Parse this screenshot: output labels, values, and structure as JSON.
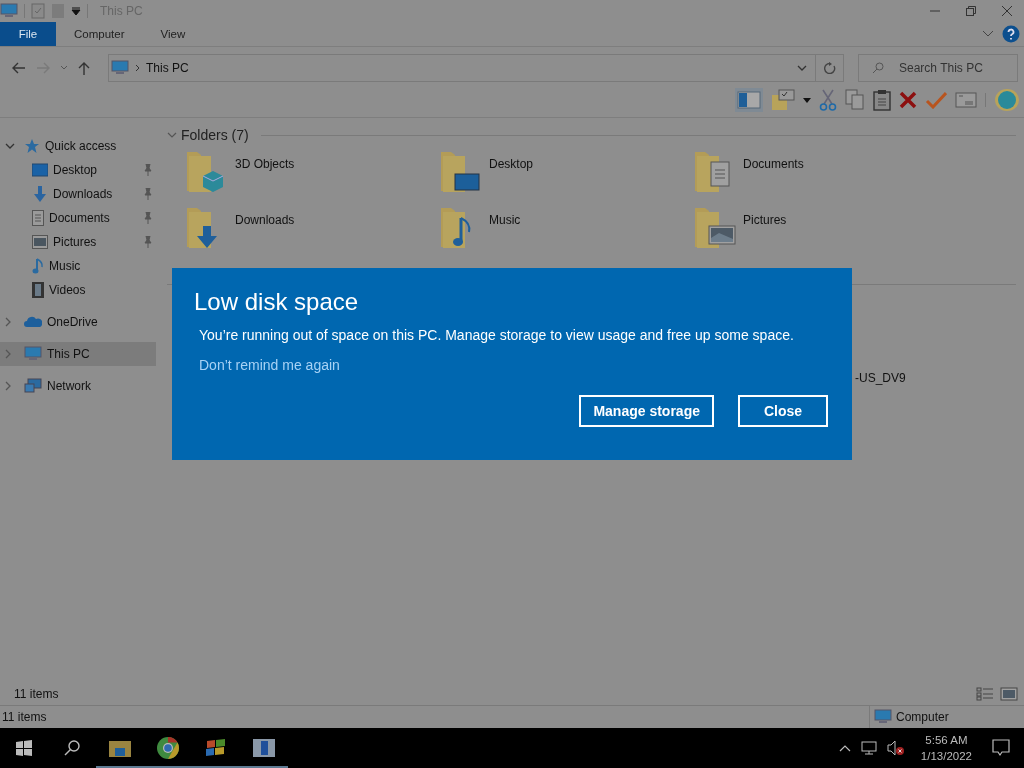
{
  "window": {
    "title": "This PC"
  },
  "ribbon": {
    "tabs": [
      {
        "label": "File",
        "kind": "file",
        "selected": false
      },
      {
        "label": "Computer",
        "kind": "tab",
        "selected": false
      },
      {
        "label": "View",
        "kind": "tab",
        "selected": false
      }
    ]
  },
  "address": {
    "path": "This PC",
    "search_placeholder": "Search This PC"
  },
  "sidebar": {
    "items": [
      {
        "label": "Quick access",
        "expanded": true,
        "selected": false,
        "children": [
          {
            "label": "Desktop",
            "pinned": true,
            "selected": false
          },
          {
            "label": "Downloads",
            "pinned": true,
            "selected": false
          },
          {
            "label": "Documents",
            "pinned": true,
            "selected": false
          },
          {
            "label": "Pictures",
            "pinned": true,
            "selected": false
          },
          {
            "label": "Music",
            "pinned": false,
            "selected": false
          },
          {
            "label": "Videos",
            "pinned": false,
            "selected": false
          }
        ]
      },
      {
        "label": "OneDrive",
        "expanded": false,
        "selected": false
      },
      {
        "label": "This PC",
        "expanded": false,
        "selected": true
      },
      {
        "label": "Network",
        "expanded": false,
        "selected": false
      }
    ]
  },
  "content": {
    "group": {
      "label": "Folders (7)",
      "expanded": true
    },
    "folders": [
      {
        "name": "3D Objects"
      },
      {
        "name": "Desktop"
      },
      {
        "name": "Documents"
      },
      {
        "name": "Downloads"
      },
      {
        "name": "Music"
      },
      {
        "name": "Pictures"
      }
    ],
    "drive_label": "-US_DV9"
  },
  "inner_status": "11 items",
  "status_bar": {
    "count": "11 items",
    "location": "Computer"
  },
  "dialog": {
    "title": "Low disk space",
    "message": "You’re running out of space on this PC. Manage storage to view usage and free up some space.",
    "link": "Don’t remind me again",
    "buttons": [
      {
        "label": "Manage storage"
      },
      {
        "label": "Close"
      }
    ]
  },
  "taskbar": {
    "time": "5:56 AM",
    "date": "1/13/2022"
  }
}
